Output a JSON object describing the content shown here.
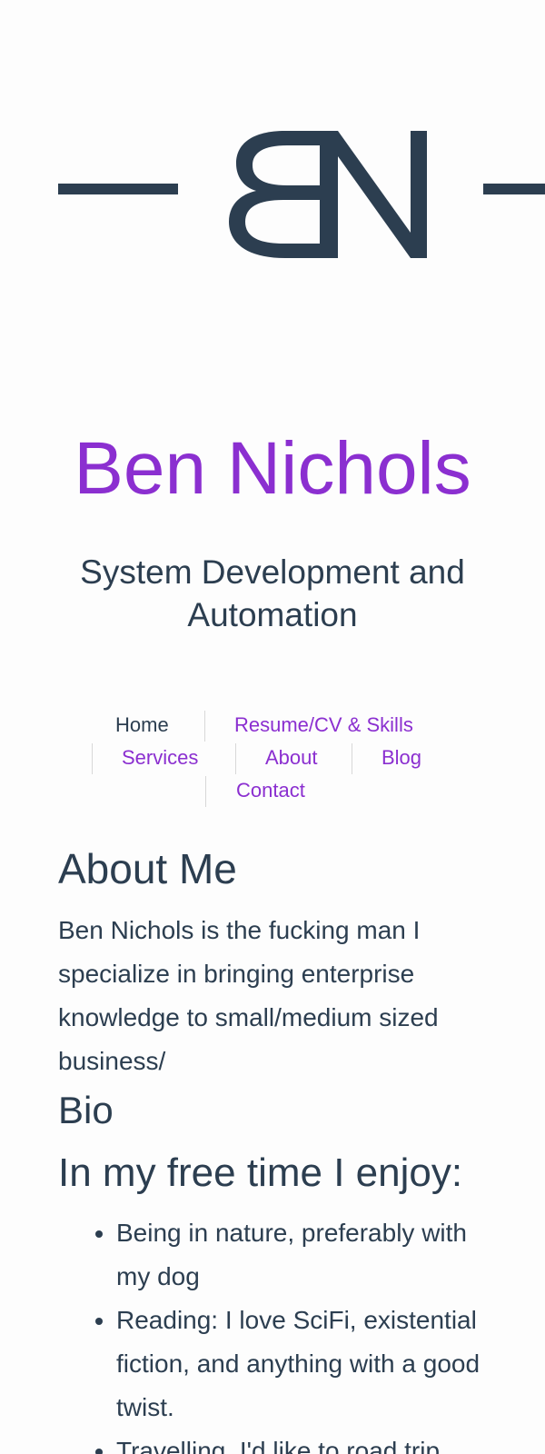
{
  "logo": {
    "alt": "BN logo"
  },
  "site": {
    "title": "Ben Nichols",
    "tagline": "System Development and Automation"
  },
  "nav": {
    "home": "Home",
    "resume": "Resume/CV & Skills",
    "services": "Services",
    "about": "About",
    "blog": "Blog",
    "contact": "Contact"
  },
  "about": {
    "heading": "About Me",
    "text": "Ben Nichols is the fucking man I specialize in bringing enterprise knowledge to small/medium sized business/"
  },
  "bio": {
    "heading": "Bio",
    "free_time_heading": "In my free time I enjoy:",
    "items": [
      "Being in nature, preferably with my dog",
      "Reading: I love SciFi, existential fiction, and anything with a good twist.",
      "Travelling. I'd like to road trip"
    ]
  },
  "colors": {
    "accent": "#8b2fd0",
    "text": "#2c3e50",
    "background": "#fdfdfd"
  }
}
